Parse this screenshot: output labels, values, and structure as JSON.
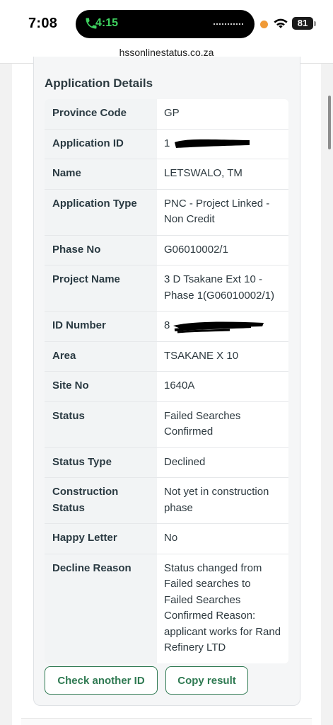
{
  "status_bar": {
    "time": "7:08",
    "call_time": "4:15",
    "battery": "81",
    "icons": [
      "phone-icon",
      "wifi-icon",
      "battery-icon"
    ]
  },
  "browser": {
    "url": "hssonlinestatus.co.za"
  },
  "details": {
    "title": "Application Details",
    "rows": [
      {
        "label": "Province Code",
        "value": "GP"
      },
      {
        "label": "Application ID",
        "value": "1"
      },
      {
        "label": "Name",
        "value": "LETSWALO, TM"
      },
      {
        "label": "Application Type",
        "value": "PNC - Project Linked - Non Credit"
      },
      {
        "label": "Phase No",
        "value": "G06010002/1"
      },
      {
        "label": "Project Name",
        "value": "3 D Tsakane Ext 10 - Phase 1(G06010002/1)"
      },
      {
        "label": "ID Number",
        "value": "8"
      },
      {
        "label": "Area",
        "value": "TSAKANE X 10"
      },
      {
        "label": "Site No",
        "value": "1640A"
      },
      {
        "label": "Status",
        "value": "Failed Searches Confirmed"
      },
      {
        "label": "Status Type",
        "value": "Declined"
      },
      {
        "label": "Construction Status",
        "value": "Not yet in construction phase"
      },
      {
        "label": "Happy Letter",
        "value": "No"
      },
      {
        "label": "Decline Reason",
        "value": "Status changed from Failed searches to Failed Searches Confirmed Reason: applicant works for Rand Refinery LTD"
      }
    ]
  },
  "actions": {
    "check_another": "Check another ID",
    "copy_result": "Copy result"
  },
  "colors": {
    "accent": "#2f7a52",
    "call_green": "#3ed15f"
  }
}
